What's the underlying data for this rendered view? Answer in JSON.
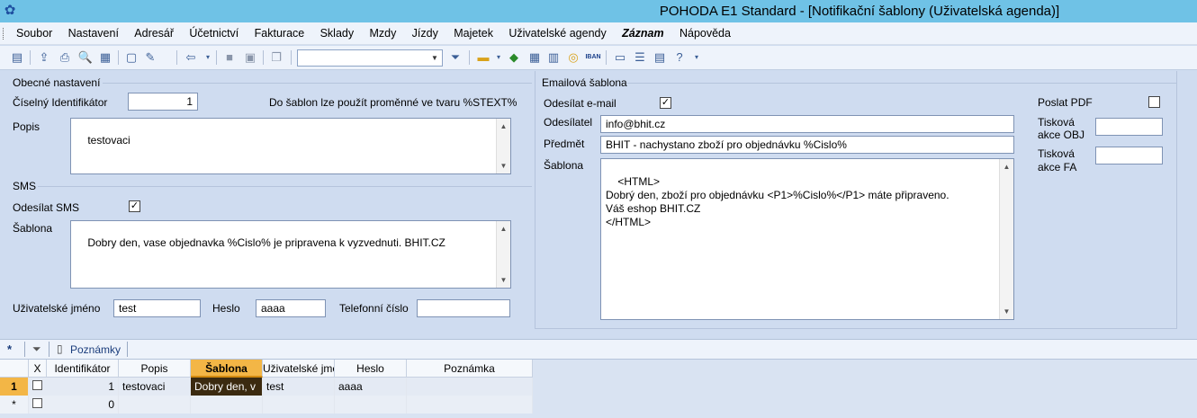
{
  "window": {
    "title": "POHODA E1 Standard - [Notifikační šablony (Uživatelská agenda)]",
    "app_icon": "paw-icon"
  },
  "menu": [
    "Soubor",
    "Nastavení",
    "Adresář",
    "Účetnictví",
    "Fakturace",
    "Sklady",
    "Mzdy",
    "Jízdy",
    "Majetek",
    "Uživatelské agendy",
    "Záznam",
    "Nápověda"
  ],
  "toolbar": {
    "combo_value": ""
  },
  "general": {
    "group_label": "Obecné nastavení",
    "id_label": "Číselný Identifikátor",
    "id_value": "1",
    "hint": "Do šablon lze použít proměnné ve tvaru %STEXT%",
    "desc_label": "Popis",
    "desc_value": "testovaci"
  },
  "sms": {
    "group_label": "SMS",
    "send_label": "Odesílat SMS",
    "send_checked": "✓",
    "template_label": "Šablona",
    "template_value": "Dobry den, vase objednavka %Cislo% je pripravena k vyzvednuti. BHIT.CZ",
    "user_label": "Uživatelské jméno",
    "user_value": "test",
    "pass_label": "Heslo",
    "pass_value": "aaaa",
    "phone_label": "Telefonní číslo",
    "phone_value": ""
  },
  "email": {
    "group_label": "Emailová šablona",
    "send_label": "Odesílat e-mail",
    "send_checked": "✓",
    "sender_label": "Odesílatel",
    "sender_value": "info@bhit.cz",
    "subject_label": "Předmět",
    "subject_value": "BHIT - nachystano zboží pro objednávku %Cislo%",
    "template_label": "Šablona",
    "template_value": "<HTML>\nDobrý den, zboží pro objednávku <P1>%Cislo%</P1> máte připraveno.\nVáš eshop BHIT.CZ\n</HTML>",
    "pdf_label": "Poslat PDF",
    "pdf_checked": "",
    "print_obj_label_1": "Tisková",
    "print_obj_label_2": "akce OBJ",
    "print_obj_value": "",
    "print_fa_label_1": "Tisková",
    "print_fa_label_2": "akce FA",
    "print_fa_value": ""
  },
  "bottom_tabs": {
    "star": "*",
    "notes_label": "Poznámky"
  },
  "grid": {
    "columns": [
      "X",
      "Identifikátor",
      "Popis",
      "Šablona",
      "Uživatelské jmé",
      "Heslo",
      "Poznámka"
    ],
    "rows": [
      {
        "marker": "1",
        "id": "1",
        "popis": "testovaci",
        "sablona": "Dobry den, v",
        "user": "test",
        "heslo": "aaaa",
        "poznamka": ""
      },
      {
        "marker": "*",
        "id": "0",
        "popis": "",
        "sablona": "",
        "user": "",
        "heslo": "",
        "poznamka": ""
      }
    ]
  },
  "colors": {
    "titlebar": "#6fc2e6",
    "panel": "#cfdcf0",
    "active_cell": "#3b2a10",
    "active_header": "#f3b646"
  }
}
